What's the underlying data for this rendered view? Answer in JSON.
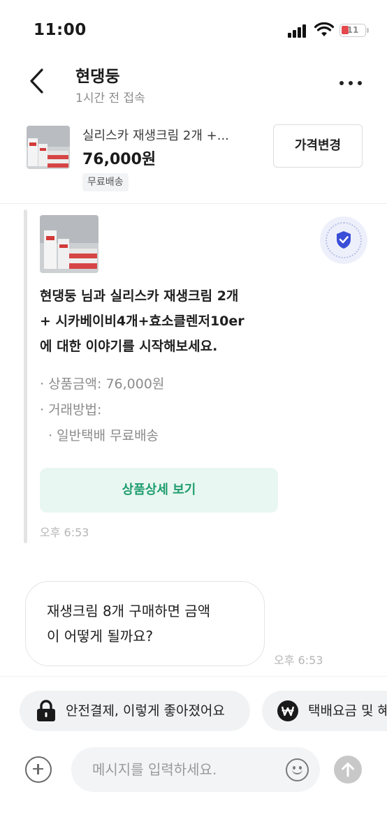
{
  "status_bar": {
    "time": "11:00",
    "battery_level": "11",
    "battery_color": "#e5484d"
  },
  "header": {
    "back_icon": "chevron-left-icon",
    "name": "현댕둥",
    "last_seen": "1시간 전 접속",
    "more_icon": "more-horizontal-icon"
  },
  "product": {
    "title": "실리스카 재생크림 2개 +...",
    "price": "76,000원",
    "badge": "무료배송",
    "price_change_label": "가격변경"
  },
  "system_card": {
    "shield_icon": "shield-check-icon",
    "shield_color": "#3b4ed8",
    "message_lines": [
      "현댕둥 님과 실리스카 재생크림 2개",
      "+ 시카베이비4개+효소클렌저10er",
      "에 대한 이야기를 시작해보세요."
    ],
    "details": [
      "· 상품금액: 76,000원",
      "· 거래방법:",
      "  · 일반택배 무료배송"
    ],
    "detail_button_label": "상품상세 보기",
    "accent_color": "#1f9d6f",
    "time": "오후 6:53"
  },
  "messages": [
    {
      "lines": [
        "재생크림 8개 구매하면 금액",
        "이 어떻게 될까요?"
      ],
      "time": "오후 6:53"
    }
  ],
  "quick_actions": [
    {
      "label": "안전결제, 이렇게 좋아졌어요",
      "icon": "lock-icon"
    },
    {
      "label": "택배요금 및 혜",
      "icon": "won-icon"
    }
  ],
  "input": {
    "placeholder": "메시지를 입력하세요.",
    "plus_icon": "plus-circle-icon",
    "emoji_icon": "smile-icon",
    "send_icon": "arrow-up-icon"
  }
}
